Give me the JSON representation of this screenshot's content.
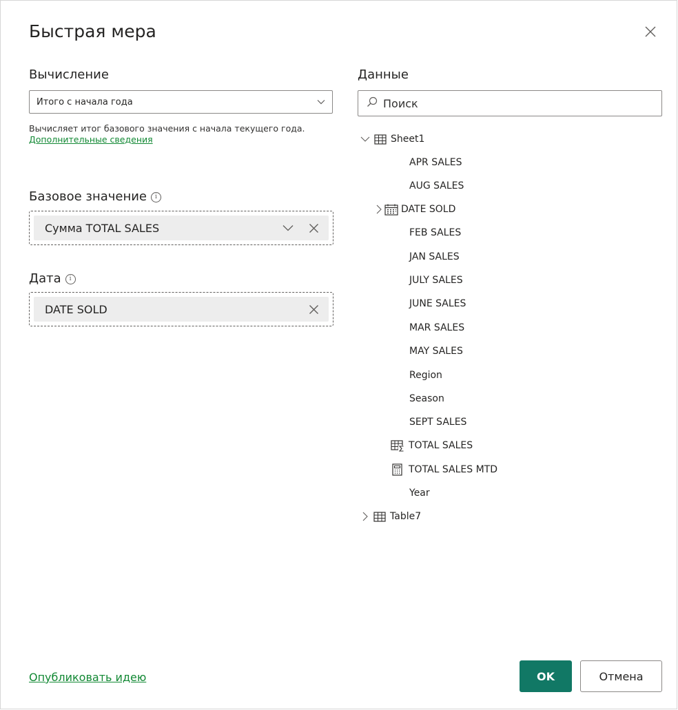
{
  "dialog": {
    "title": "Быстрая мера",
    "close_icon": "close-icon"
  },
  "calculation": {
    "label": "Вычисление",
    "selected": "Итого с начала года",
    "description": "Вычисляет итог базового значения с начала текущего года.",
    "learn_more": "Дополнительные сведения"
  },
  "base_value": {
    "label": "Базовое значение",
    "info_icon": "info-icon",
    "field": "Сумма TOTAL SALES"
  },
  "date": {
    "label": "Дата",
    "info_icon": "info-icon",
    "field": "DATE SOLD"
  },
  "data_pane": {
    "label": "Данные",
    "search_placeholder": "Поиск",
    "tables": [
      {
        "name": "Sheet1",
        "expanded": true,
        "icon": "table-icon",
        "fields": [
          {
            "name": "APR SALES",
            "icon": "none"
          },
          {
            "name": "AUG SALES",
            "icon": "none"
          },
          {
            "name": "DATE SOLD",
            "icon": "calendar-icon",
            "expandable": true
          },
          {
            "name": "FEB SALES",
            "icon": "none"
          },
          {
            "name": "JAN SALES",
            "icon": "none"
          },
          {
            "name": "JULY SALES",
            "icon": "none"
          },
          {
            "name": "JUNE SALES",
            "icon": "none"
          },
          {
            "name": "MAR SALES",
            "icon": "none"
          },
          {
            "name": "MAY SALES",
            "icon": "none"
          },
          {
            "name": "Region",
            "icon": "none"
          },
          {
            "name": "Season",
            "icon": "none"
          },
          {
            "name": "SEPT SALES",
            "icon": "none"
          },
          {
            "name": "TOTAL SALES",
            "icon": "sum-table-icon"
          },
          {
            "name": "TOTAL SALES MTD",
            "icon": "calculator-icon"
          },
          {
            "name": "Year",
            "icon": "none"
          }
        ]
      },
      {
        "name": "Table7",
        "expanded": false,
        "icon": "table-icon"
      }
    ]
  },
  "footer": {
    "feedback_link": "Опубликовать идею",
    "ok_label": "OK",
    "cancel_label": "Отмена"
  },
  "colors": {
    "accent": "#117865",
    "link": "#118833",
    "pill_bg": "#ededed"
  }
}
